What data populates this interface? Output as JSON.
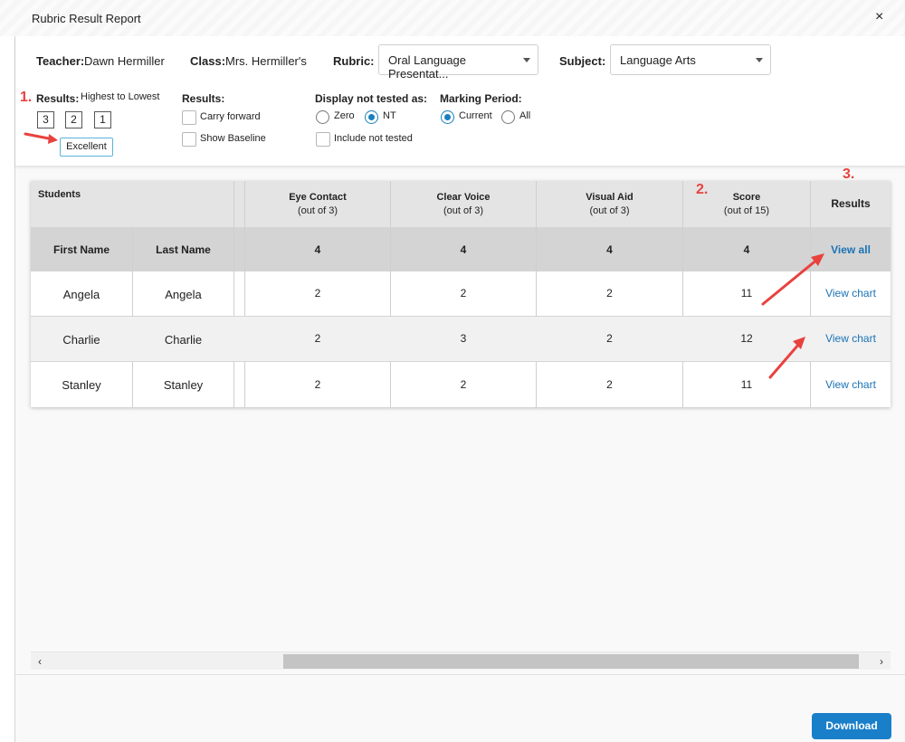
{
  "dialog": {
    "title": "Rubric Result Report",
    "close_glyph": "×"
  },
  "filters": {
    "teacher_label": "Teacher:",
    "teacher_value": "Dawn Hermiller",
    "class_label": "Class:",
    "class_value": "Mrs. Hermiller's",
    "rubric_label": "Rubric:",
    "rubric_value": "Oral Language Presentat...",
    "subject_label": "Subject:",
    "subject_value": "Language Arts",
    "results_label": "Results:",
    "results_order": "Highest to Lowest",
    "score_boxes": [
      "3",
      "2",
      "1"
    ],
    "selected_level": "Excellent",
    "results2_label": "Results:",
    "carry_forward": "Carry forward",
    "show_baseline": "Show Baseline",
    "display_label": "Display not tested as:",
    "zero": "Zero",
    "nt": "NT",
    "display_selected": "NT",
    "include_not_tested": "Include not tested",
    "marking_label": "Marking Period:",
    "current": "Current",
    "all": "All",
    "marking_selected": "Current"
  },
  "annotations": [
    "1.",
    "2.",
    "3."
  ],
  "table": {
    "students_header": "Students",
    "first_name": "First Name",
    "last_name": "Last Name",
    "criteria": [
      {
        "name": "Eye Contact",
        "max": "(out of 3)",
        "top": "4"
      },
      {
        "name": "Clear Voice",
        "max": "(out of 3)",
        "top": "4"
      },
      {
        "name": "Visual Aid",
        "max": "(out of 3)",
        "top": "4"
      },
      {
        "name": "Score",
        "max": "(out of 15)",
        "top": "4"
      }
    ],
    "results_header": "Results",
    "view_all": "View all",
    "rows": [
      {
        "first": "Angela",
        "last": "Angela",
        "eye": "2",
        "voice": "2",
        "aid": "2",
        "score": "11",
        "link": "View chart"
      },
      {
        "first": "Charlie",
        "last": "Charlie",
        "eye": "2",
        "voice": "3",
        "aid": "2",
        "score": "12",
        "link": "View chart"
      },
      {
        "first": "Stanley",
        "last": "Stanley",
        "eye": "2",
        "voice": "2",
        "aid": "2",
        "score": "11",
        "link": "View chart"
      }
    ]
  },
  "scroll": {
    "left": "‹",
    "right": "›"
  },
  "footer": {
    "download": "Download"
  },
  "colors": {
    "accent": "#1a7fc9",
    "annotation": "#e8423f",
    "link": "#1a73b5"
  }
}
